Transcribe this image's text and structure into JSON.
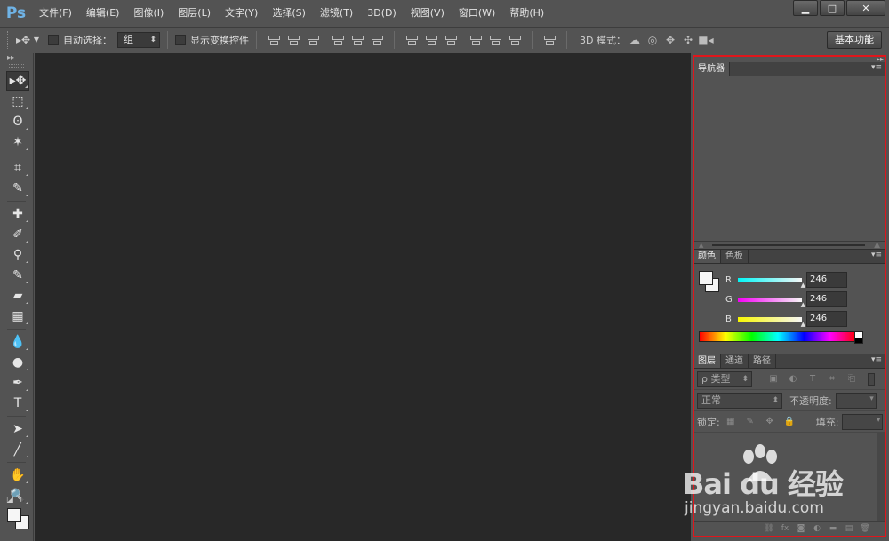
{
  "app": {
    "logo": "Ps"
  },
  "menu": [
    "文件(F)",
    "编辑(E)",
    "图像(I)",
    "图层(L)",
    "文字(Y)",
    "选择(S)",
    "滤镜(T)",
    "3D(D)",
    "视图(V)",
    "窗口(W)",
    "帮助(H)"
  ],
  "window_controls": {
    "minimize": "▁",
    "maximize": "□",
    "close": "✕"
  },
  "options": {
    "auto_select_label": "自动选择：",
    "auto_select_value": "组",
    "show_transform_label": "显示变换控件",
    "mode3d_label": "3D 模式：",
    "workspace": "基本功能"
  },
  "tools": [
    "move-tool",
    "marquee-tool",
    "lasso-tool",
    "magic-wand-tool",
    "crop-tool",
    "eyedropper-tool",
    "spot-healing-tool",
    "brush-tool",
    "clone-stamp-tool",
    "history-brush-tool",
    "eraser-tool",
    "gradient-tool",
    "blur-tool",
    "dodge-tool",
    "pen-tool",
    "type-tool",
    "path-selection-tool",
    "line-tool",
    "hand-tool",
    "zoom-tool"
  ],
  "tool_glyphs": [
    "▸✥",
    "⬚",
    "ʘ",
    "✶",
    "⌗",
    "✎",
    "✚",
    "✐",
    "⚲",
    "✎",
    "▰",
    "▦",
    "💧",
    "●",
    "✒",
    "T",
    "➤",
    "╱",
    "✋",
    "🔍"
  ],
  "panels": {
    "navigator": {
      "tab": "导航器"
    },
    "color": {
      "tabs": [
        "颜色",
        "色板"
      ],
      "r_label": "R",
      "g_label": "G",
      "b_label": "B",
      "r": "246",
      "g": "246",
      "b": "246",
      "fg_color": "#f6f6f6",
      "bg_color": "#f6f6f6"
    },
    "layers": {
      "tabs": [
        "图层",
        "通道",
        "路径"
      ],
      "filter_kind": "ρ 类型",
      "blend_mode": "正常",
      "opacity_label": "不透明度:",
      "lock_label": "锁定:",
      "fill_label": "填充:"
    }
  },
  "watermark": {
    "logo": "Bai du 经验",
    "url": "jingyan.baidu.com"
  },
  "highlight_color": "#e0161c"
}
